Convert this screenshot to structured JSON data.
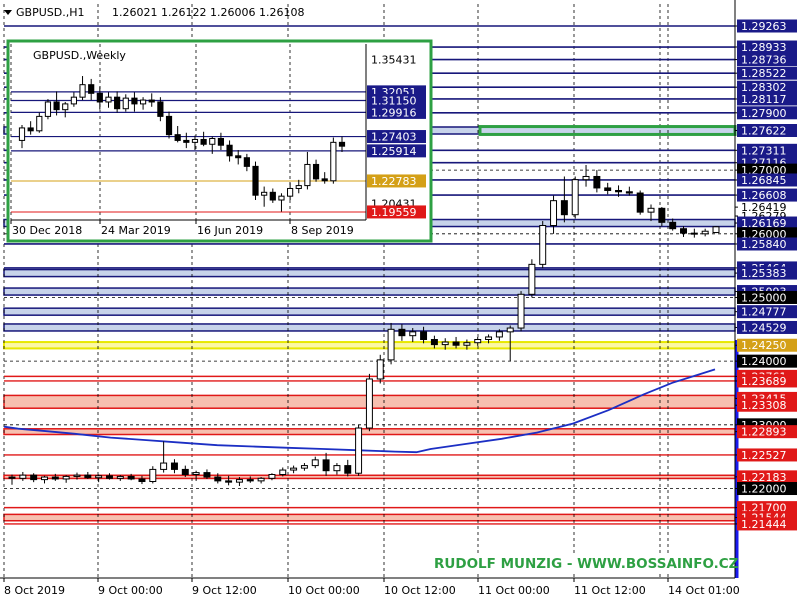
{
  "header": {
    "symbol": "GBPUSD.,H1",
    "ohlc": "1.26021 1.26122 1.26006 1.26108"
  },
  "watermark": "RUDOLF MUNZIG - WWW.BOSSAINFO.CZ",
  "colors": {
    "candle": "#000000",
    "ma": "#1c2fc4",
    "blue_level": "#17177a",
    "blue_band": "#c7d3ea",
    "red_level": "#e01818",
    "red_band": "#f7c0b0",
    "yellow_level": "#e8e800",
    "green_box": "#2ea043",
    "grid": "#000000",
    "label_blue": "#1a1a88",
    "label_red": "#e01818",
    "label_black": "#000000",
    "label_yellow": "#d4a017"
  },
  "chart_data": [
    {
      "type": "candlestick",
      "title": "GBPUSD.,H1",
      "x_ticks": [
        "8 Oct 2019",
        "9 Oct 00:00",
        "9 Oct 12:00",
        "10 Oct 00:00",
        "10 Oct 12:00",
        "11 Oct 00:00",
        "11 Oct 12:00",
        "14 Oct 01:00"
      ],
      "ylim": [
        1.2138,
        1.2942
      ],
      "price_labels": [
        {
          "v": 1.29263,
          "t": "1.29263",
          "s": "blue"
        },
        {
          "v": 1.28933,
          "t": "1.28933",
          "s": "blue"
        },
        {
          "v": 1.28736,
          "t": "1.28736",
          "s": "blue"
        },
        {
          "v": 1.28522,
          "t": "1.28522",
          "s": "blue"
        },
        {
          "v": 1.28302,
          "t": "1.28302",
          "s": "blue"
        },
        {
          "v": 1.28117,
          "t": "1.28117",
          "s": "blue"
        },
        {
          "v": 1.279,
          "t": "1.27900",
          "s": "blue"
        },
        {
          "v": 1.27622,
          "t": "1.27622",
          "s": "blue"
        },
        {
          "v": 1.27311,
          "t": "1.27311",
          "s": "blue"
        },
        {
          "v": 1.27116,
          "t": "1.27116",
          "s": "blue"
        },
        {
          "v": 1.27,
          "t": "1.27000",
          "s": "black"
        },
        {
          "v": 1.26845,
          "t": "1.26845",
          "s": "blue"
        },
        {
          "v": 1.26608,
          "t": "1.26608",
          "s": "blue"
        },
        {
          "v": 1.26419,
          "t": "1.26419",
          "s": "plain"
        },
        {
          "v": 1.26279,
          "t": "1.26279",
          "s": "plain"
        },
        {
          "v": 1.26169,
          "t": "1.26169",
          "s": "blue"
        },
        {
          "v": 1.26,
          "t": "1.26000",
          "s": "black"
        },
        {
          "v": 1.2584,
          "t": "1.25840",
          "s": "blue"
        },
        {
          "v": 1.25464,
          "t": "1.25464",
          "s": "blue"
        },
        {
          "v": 1.25383,
          "t": "1.25383",
          "s": "blue"
        },
        {
          "v": 1.25093,
          "t": "1.25093",
          "s": "blue"
        },
        {
          "v": 1.25,
          "t": "1.25000",
          "s": "black"
        },
        {
          "v": 1.24777,
          "t": "1.24777",
          "s": "blue"
        },
        {
          "v": 1.24529,
          "t": "1.24529",
          "s": "blue"
        },
        {
          "v": 1.2425,
          "t": "1.24250",
          "s": "yellow"
        },
        {
          "v": 1.24,
          "t": "1.24000",
          "s": "black"
        },
        {
          "v": 1.23761,
          "t": "1.23761",
          "s": "red"
        },
        {
          "v": 1.23689,
          "t": "1.23689",
          "s": "red"
        },
        {
          "v": 1.23415,
          "t": "1.23415",
          "s": "red"
        },
        {
          "v": 1.23308,
          "t": "1.23308",
          "s": "red"
        },
        {
          "v": 1.23,
          "t": "1.23000",
          "s": "black"
        },
        {
          "v": 1.22893,
          "t": "1.22893",
          "s": "red"
        },
        {
          "v": 1.22527,
          "t": "1.22527",
          "s": "red"
        },
        {
          "v": 1.22183,
          "t": "1.22183",
          "s": "red"
        },
        {
          "v": 1.22,
          "t": "1.22000",
          "s": "black"
        },
        {
          "v": 1.217,
          "t": "1.21700",
          "s": "red"
        },
        {
          "v": 1.21544,
          "t": "1.21544",
          "s": "red"
        },
        {
          "v": 1.21444,
          "t": "1.21444",
          "s": "red"
        }
      ],
      "blue_bands": [
        [
          1.27567,
          1.27677
        ],
        [
          1.26114,
          1.26224
        ],
        [
          1.25328,
          1.25438
        ],
        [
          1.25038,
          1.25148
        ],
        [
          1.24722,
          1.24832
        ],
        [
          1.24474,
          1.24584
        ]
      ],
      "blue_lines": [
        1.29263,
        1.28933,
        1.28736,
        1.28522,
        1.28302,
        1.28117,
        1.279,
        1.27311,
        1.27116,
        1.26845,
        1.26608,
        1.2584,
        1.25464
      ],
      "red_bands": [
        [
          1.22158,
          1.22208
        ],
        [
          1.23261,
          1.23462
        ],
        [
          1.22848,
          1.22938
        ],
        [
          1.21494,
          1.21594
        ]
      ],
      "red_lines": [
        1.23761,
        1.23689,
        1.22527,
        1.217,
        1.21444
      ],
      "yellow_band": [
        1.242,
        1.243
      ],
      "green_box": [
        1.2756,
        1.27684
      ],
      "ma": [
        [
          0,
          1.2297
        ],
        [
          0.02,
          1.2294
        ],
        [
          0.06,
          1.229
        ],
        [
          0.1,
          1.2286
        ],
        [
          0.15,
          1.228
        ],
        [
          0.2,
          1.2276
        ],
        [
          0.25,
          1.2272
        ],
        [
          0.3,
          1.2268
        ],
        [
          0.35,
          1.2266
        ],
        [
          0.4,
          1.2264
        ],
        [
          0.45,
          1.2262
        ],
        [
          0.5,
          1.226
        ],
        [
          0.55,
          1.2258
        ],
        [
          0.58,
          1.2257
        ],
        [
          0.6,
          1.2262
        ],
        [
          0.65,
          1.227
        ],
        [
          0.7,
          1.2278
        ],
        [
          0.75,
          1.2288
        ],
        [
          0.8,
          1.2302
        ],
        [
          0.85,
          1.2323
        ],
        [
          0.9,
          1.2348
        ],
        [
          0.94,
          1.2366
        ],
        [
          0.98,
          1.238
        ],
        [
          1.0,
          1.2387
        ]
      ],
      "candles": [
        [
          1.2218,
          1.2222,
          1.2206,
          1.2216
        ],
        [
          1.2216,
          1.2226,
          1.2212,
          1.2221
        ],
        [
          1.2221,
          1.2224,
          1.221,
          1.2214
        ],
        [
          1.2214,
          1.222,
          1.2208,
          1.2218
        ],
        [
          1.2218,
          1.2223,
          1.2212,
          1.2215
        ],
        [
          1.2215,
          1.2221,
          1.2209,
          1.2219
        ],
        [
          1.2219,
          1.2225,
          1.2214,
          1.2221
        ],
        [
          1.2221,
          1.2226,
          1.2215,
          1.2217
        ],
        [
          1.2217,
          1.2222,
          1.221,
          1.222
        ],
        [
          1.222,
          1.2224,
          1.2214,
          1.2216
        ],
        [
          1.2216,
          1.2221,
          1.2212,
          1.2219
        ],
        [
          1.2219,
          1.2223,
          1.2213,
          1.2215
        ],
        [
          1.2215,
          1.222,
          1.2207,
          1.2211
        ],
        [
          1.2211,
          1.2235,
          1.2208,
          1.223
        ],
        [
          1.223,
          1.2274,
          1.2225,
          1.224
        ],
        [
          1.224,
          1.2246,
          1.2224,
          1.223
        ],
        [
          1.223,
          1.2236,
          1.2218,
          1.2222
        ],
        [
          1.2222,
          1.2228,
          1.2212,
          1.2225
        ],
        [
          1.2225,
          1.223,
          1.2215,
          1.2218
        ],
        [
          1.2218,
          1.2224,
          1.2208,
          1.2212
        ],
        [
          1.2212,
          1.222,
          1.2205,
          1.221
        ],
        [
          1.221,
          1.2218,
          1.2204,
          1.2214
        ],
        [
          1.2214,
          1.2219,
          1.2209,
          1.2212
        ],
        [
          1.2212,
          1.2218,
          1.2208,
          1.2216
        ],
        [
          1.2216,
          1.2224,
          1.2213,
          1.2222
        ],
        [
          1.2222,
          1.2233,
          1.2219,
          1.2229
        ],
        [
          1.2229,
          1.2236,
          1.2224,
          1.2232
        ],
        [
          1.2232,
          1.224,
          1.2228,
          1.2236
        ],
        [
          1.2236,
          1.225,
          1.2232,
          1.2245
        ],
        [
          1.2245,
          1.2256,
          1.222,
          1.2228
        ],
        [
          1.2228,
          1.224,
          1.2222,
          1.2236
        ],
        [
          1.2236,
          1.2245,
          1.2219,
          1.2224
        ],
        [
          1.2224,
          1.23,
          1.222,
          1.2295
        ],
        [
          1.2295,
          1.238,
          1.229,
          1.2372
        ],
        [
          1.2372,
          1.241,
          1.2365,
          1.2402
        ],
        [
          1.2402,
          1.246,
          1.2395,
          1.245
        ],
        [
          1.245,
          1.2458,
          1.2432,
          1.244
        ],
        [
          1.244,
          1.2452,
          1.243,
          1.2446
        ],
        [
          1.2446,
          1.2454,
          1.2428,
          1.2434
        ],
        [
          1.2434,
          1.244,
          1.242,
          1.2426
        ],
        [
          1.2426,
          1.2436,
          1.2418,
          1.243
        ],
        [
          1.243,
          1.2438,
          1.242,
          1.2425
        ],
        [
          1.2425,
          1.2434,
          1.2418,
          1.2429
        ],
        [
          1.2429,
          1.2438,
          1.2424,
          1.2434
        ],
        [
          1.2434,
          1.2442,
          1.2428,
          1.2438
        ],
        [
          1.2438,
          1.245,
          1.2432,
          1.2446
        ],
        [
          1.2446,
          1.2456,
          1.24,
          1.2452
        ],
        [
          1.2452,
          1.251,
          1.2447,
          1.2505
        ],
        [
          1.2505,
          1.256,
          1.25,
          1.2552
        ],
        [
          1.2552,
          1.262,
          1.2546,
          1.2613
        ],
        [
          1.2613,
          1.266,
          1.26,
          1.2652
        ],
        [
          1.2652,
          1.269,
          1.2618,
          1.263
        ],
        [
          1.263,
          1.269,
          1.2624,
          1.2685
        ],
        [
          1.2685,
          1.2708,
          1.2674,
          1.269
        ],
        [
          1.269,
          1.27,
          1.2665,
          1.2672
        ],
        [
          1.2672,
          1.268,
          1.2662,
          1.2668
        ],
        [
          1.2668,
          1.2676,
          1.2658,
          1.2666
        ],
        [
          1.2666,
          1.2674,
          1.266,
          1.2664
        ],
        [
          1.2664,
          1.2668,
          1.263,
          1.2634
        ],
        [
          1.2634,
          1.2646,
          1.262,
          1.264
        ],
        [
          1.264,
          1.2642,
          1.2612,
          1.2618
        ],
        [
          1.2618,
          1.2624,
          1.2605,
          1.2608
        ],
        [
          1.2608,
          1.2612,
          1.2595,
          1.2601
        ],
        [
          1.2601,
          1.2608,
          1.2594,
          1.26
        ],
        [
          1.26,
          1.2608,
          1.2596,
          1.2604
        ],
        [
          1.2602,
          1.2612,
          1.2601,
          1.2611
        ]
      ]
    },
    {
      "type": "candlestick",
      "title": "GBPUSD.,Weekly",
      "x_ticks": [
        "30 Dec 2018",
        "24 Mar 2019",
        "16 Jun 2019",
        "8 Sep 2019"
      ],
      "ylim": [
        1.182,
        1.362
      ],
      "price_labels": [
        {
          "v": 1.35431,
          "t": "1.35431",
          "s": "plain"
        },
        {
          "v": 1.32051,
          "t": "1.32051",
          "s": "blue"
        },
        {
          "v": 1.3115,
          "t": "1.31150",
          "s": "blue"
        },
        {
          "v": 1.29916,
          "t": "1.29916",
          "s": "blue"
        },
        {
          "v": 1.27403,
          "t": "1.27403",
          "s": "blue"
        },
        {
          "v": 1.25914,
          "t": "1.25914",
          "s": "blue"
        },
        {
          "v": 1.22783,
          "t": "1.22783",
          "s": "yellow"
        },
        {
          "v": 1.20431,
          "t": "1.20431",
          "s": "plain"
        },
        {
          "v": 1.19559,
          "t": "1.19559",
          "s": "red"
        }
      ],
      "blue_lines": [
        1.32051,
        1.3115,
        1.29916,
        1.27403,
        1.25914
      ],
      "yellow_line": 1.22783,
      "red_line": 1.19559,
      "candles": [
        [
          1.27,
          1.286,
          1.262,
          1.283
        ],
        [
          1.283,
          1.29,
          1.276,
          1.28
        ],
        [
          1.28,
          1.299,
          1.278,
          1.295
        ],
        [
          1.295,
          1.313,
          1.292,
          1.31
        ],
        [
          1.31,
          1.321,
          1.296,
          1.302
        ],
        [
          1.302,
          1.31,
          1.294,
          1.308
        ],
        [
          1.308,
          1.32,
          1.305,
          1.315
        ],
        [
          1.315,
          1.337,
          1.312,
          1.328
        ],
        [
          1.328,
          1.334,
          1.312,
          1.319
        ],
        [
          1.319,
          1.326,
          1.302,
          1.31
        ],
        [
          1.31,
          1.32,
          1.304,
          1.315
        ],
        [
          1.315,
          1.321,
          1.299,
          1.303
        ],
        [
          1.303,
          1.318,
          1.3,
          1.314
        ],
        [
          1.314,
          1.32,
          1.3,
          1.308
        ],
        [
          1.308,
          1.315,
          1.302,
          1.312
        ],
        [
          1.312,
          1.319,
          1.305,
          1.31
        ],
        [
          1.31,
          1.315,
          1.29,
          1.295
        ],
        [
          1.295,
          1.3,
          1.272,
          1.276
        ],
        [
          1.276,
          1.285,
          1.268,
          1.27
        ],
        [
          1.27,
          1.278,
          1.262,
          1.268
        ],
        [
          1.268,
          1.275,
          1.26,
          1.271
        ],
        [
          1.271,
          1.279,
          1.264,
          1.266
        ],
        [
          1.266,
          1.274,
          1.256,
          1.272
        ],
        [
          1.272,
          1.278,
          1.26,
          1.265
        ],
        [
          1.265,
          1.27,
          1.248,
          1.254
        ],
        [
          1.254,
          1.26,
          1.245,
          1.252
        ],
        [
          1.252,
          1.256,
          1.238,
          1.243
        ],
        [
          1.243,
          1.248,
          1.208,
          1.213
        ],
        [
          1.213,
          1.222,
          1.201,
          1.216
        ],
        [
          1.216,
          1.22,
          1.205,
          1.208
        ],
        [
          1.208,
          1.215,
          1.196,
          1.212
        ],
        [
          1.212,
          1.226,
          1.208,
          1.22
        ],
        [
          1.22,
          1.229,
          1.215,
          1.223
        ],
        [
          1.223,
          1.258,
          1.219,
          1.245
        ],
        [
          1.245,
          1.25,
          1.227,
          1.23
        ],
        [
          1.23,
          1.237,
          1.225,
          1.228
        ],
        [
          1.228,
          1.273,
          1.225,
          1.268
        ],
        [
          1.268,
          1.274,
          1.258,
          1.264
        ]
      ]
    }
  ]
}
